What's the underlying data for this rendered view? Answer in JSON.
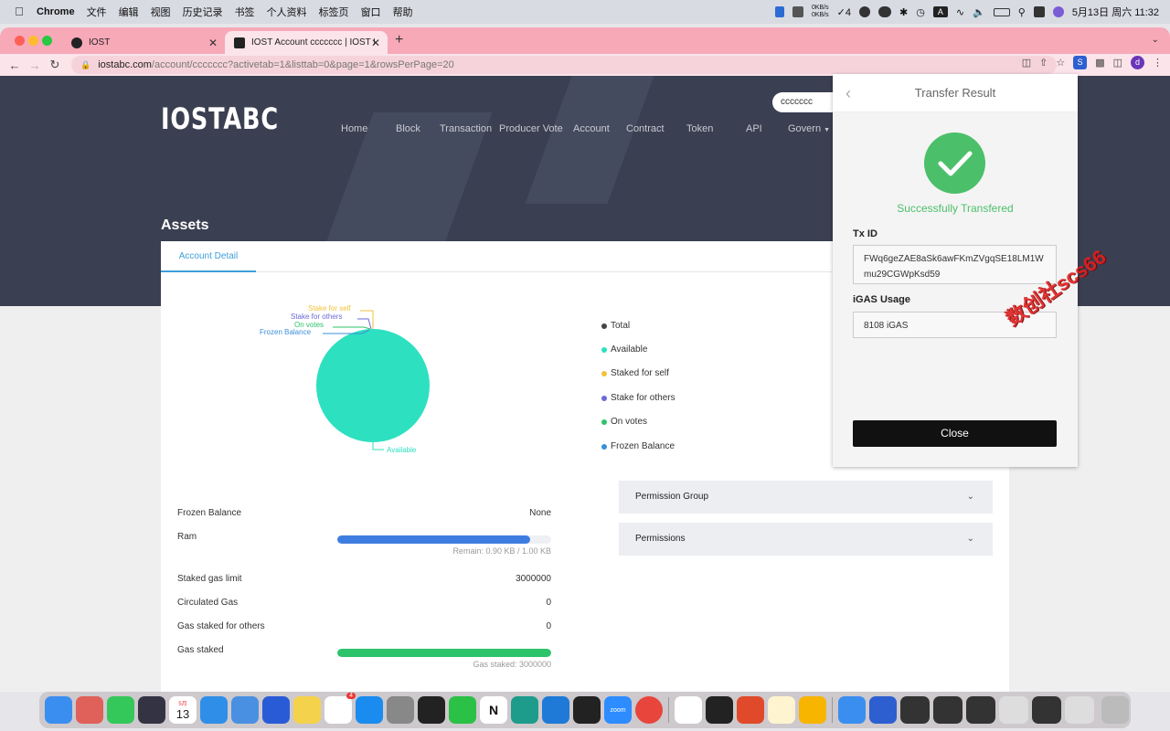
{
  "menubar": {
    "app": "Chrome",
    "items": [
      "文件",
      "编辑",
      "视图",
      "历史记录",
      "书签",
      "个人资料",
      "标签页",
      "窗口",
      "帮助"
    ],
    "netspeed_up": "0KB/s",
    "netspeed_down": "0KB/s",
    "tasks_count": "4",
    "date_time": "5月13日 周六 11:32"
  },
  "browser": {
    "tabs": [
      {
        "title": "IOST",
        "active": false
      },
      {
        "title": "IOST Account ccccccc | IOST E",
        "active": true
      }
    ],
    "url_host": "iostabc.com",
    "url_path": "/account/ccccccc?activetab=1&listtab=0&page=1&rowsPerPage=20",
    "profile_initial": "d"
  },
  "site": {
    "logo": "IOSTABC",
    "nav": [
      "Home",
      "Block",
      "Transaction",
      "Producer Vote",
      "Account",
      "Contract",
      "Token",
      "API",
      "Govern"
    ],
    "search_value": "ccccccc"
  },
  "assets": {
    "title": "Assets",
    "tab": "Account Detail",
    "pie_labels": {
      "stake_self": "Stake for self",
      "stake_others": "Stake for others",
      "on_votes": "On votes",
      "frozen": "Frozen Balance",
      "available": "Available"
    },
    "legend": [
      {
        "label": "Total",
        "color": "#444444"
      },
      {
        "label": "Available",
        "color": "#2de0c0"
      },
      {
        "label": "Staked for self",
        "color": "#f2c23a"
      },
      {
        "label": "Stake for others",
        "color": "#6a6ad8"
      },
      {
        "label": "On votes",
        "color": "#2cc36b"
      },
      {
        "label": "Frozen Balance",
        "color": "#3a8fd8"
      }
    ],
    "rows": {
      "frozen_label": "Frozen Balance",
      "frozen_value": "None",
      "ram_label": "Ram",
      "ram_fraction": 0.9,
      "ram_note": "Remain: 0.90 KB / 1.00 KB",
      "staked_gas_label": "Staked gas limit",
      "staked_gas_value": "3000000",
      "circulated_label": "Circulated Gas",
      "circulated_value": "0",
      "gas_others_label": "Gas staked for others",
      "gas_others_value": "0",
      "gas_staked_label": "Gas staked",
      "gas_staked_fraction": 1.0,
      "gas_staked_note": "Gas staked: 3000000"
    },
    "accordions": [
      "Permission Group",
      "Permissions"
    ]
  },
  "modal": {
    "title": "Transfer Result",
    "status": "Successfully Transfered",
    "txid_label": "Tx ID",
    "txid_value": "FWq6geZAE8aSk6awFKmZVgqSE18LM1Wmu29CGWpKsd59",
    "igas_label": "iGAS Usage",
    "igas_value": "8108 iGAS",
    "close_label": "Close"
  },
  "watermark": "数创社scs66",
  "dock": {
    "calendar_month": "5月",
    "calendar_day": "13",
    "badge_reminders": "4"
  }
}
